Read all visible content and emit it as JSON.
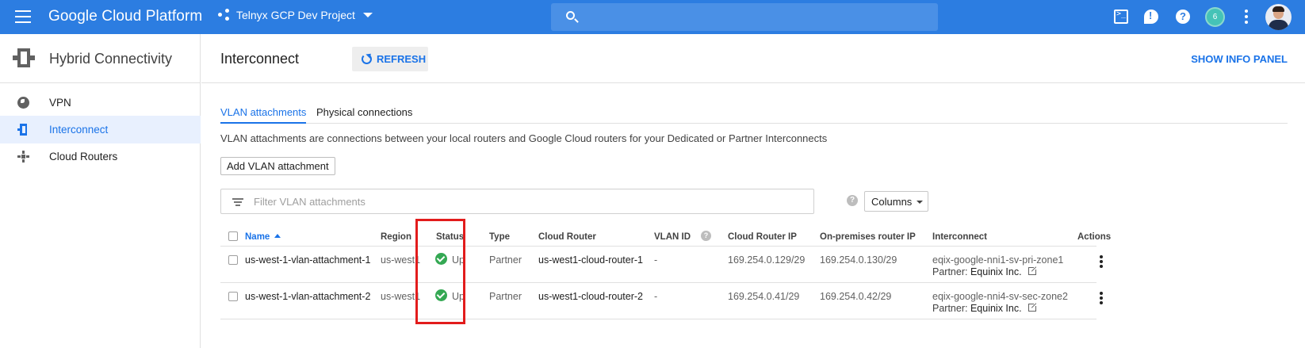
{
  "topbar": {
    "brand": "Google Cloud Platform",
    "project": "Telnyx GCP Dev Project",
    "notifications_count": "6",
    "icons": [
      "menu-icon",
      "project-icon",
      "search-icon",
      "cloud-shell-icon",
      "feedback-icon",
      "help-icon",
      "more-vert-icon",
      "avatar"
    ]
  },
  "sidebar": {
    "title": "Hybrid Connectivity",
    "items": [
      {
        "label": "VPN",
        "icon": "globe-icon",
        "active": false
      },
      {
        "label": "Interconnect",
        "icon": "interconnect-icon",
        "active": true
      },
      {
        "label": "Cloud Routers",
        "icon": "router-icon",
        "active": false
      }
    ]
  },
  "main": {
    "title": "Interconnect",
    "refresh_label": "REFRESH",
    "show_info_panel": "SHOW INFO PANEL",
    "tabs": [
      {
        "label": "VLAN attachments",
        "active": true
      },
      {
        "label": "Physical connections",
        "active": false
      }
    ],
    "description": "VLAN attachments are connections between your local routers and Google Cloud routers for your Dedicated or Partner Interconnects",
    "add_button": "Add VLAN attachment",
    "filter_placeholder": "Filter VLAN attachments",
    "columns_label": "Columns"
  },
  "table": {
    "headers": {
      "name": "Name",
      "region": "Region",
      "status": "Status",
      "type": "Type",
      "cloud_router": "Cloud Router",
      "vlan_id": "VLAN ID",
      "cloud_router_ip": "Cloud Router IP",
      "onprem_ip": "On-premises router IP",
      "interconnect": "Interconnect",
      "actions": "Actions"
    },
    "partner_prefix": "Partner:",
    "rows": [
      {
        "name": "us-west-1-vlan-attachment-1",
        "region": "us-west1",
        "status": "Up",
        "type": "Partner",
        "cloud_router": "us-west1-cloud-router-1",
        "vlan_id": "-",
        "cloud_router_ip": "169.254.0.129/29",
        "onprem_ip": "169.254.0.130/29",
        "interconnect": "eqix-google-nni1-sv-pri-zone1",
        "partner": "Equinix Inc."
      },
      {
        "name": "us-west-1-vlan-attachment-2",
        "region": "us-west1",
        "status": "Up",
        "type": "Partner",
        "cloud_router": "us-west1-cloud-router-2",
        "vlan_id": "-",
        "cloud_router_ip": "169.254.0.41/29",
        "onprem_ip": "169.254.0.42/29",
        "interconnect": "eqix-google-nni4-sv-sec-zone2",
        "partner": "Equinix Inc."
      }
    ]
  },
  "colors": {
    "topbar": "#2c7de1",
    "accent": "#1a73e8",
    "status_ok": "#34a853",
    "annotation": "#e21c1c"
  }
}
